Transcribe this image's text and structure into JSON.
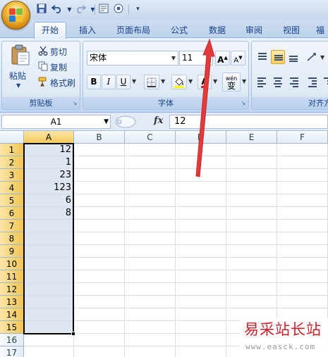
{
  "tabs": [
    {
      "label": "开始",
      "active": true
    },
    {
      "label": "插入"
    },
    {
      "label": "页面布局"
    },
    {
      "label": "公式"
    },
    {
      "label": "数据"
    },
    {
      "label": "审阅"
    },
    {
      "label": "视图"
    },
    {
      "label": "福"
    }
  ],
  "clipboard": {
    "paste": "粘贴",
    "cut": "剪切",
    "copy": "复制",
    "format_painter": "格式刷",
    "group_label": "剪贴板"
  },
  "font": {
    "name": "宋体",
    "size": "11",
    "bold": "B",
    "italic": "I",
    "underline": "U",
    "grow": "A",
    "shrink": "A",
    "phonetic": "wén",
    "phonetic_char": "变",
    "group_label": "字体"
  },
  "alignment": {
    "group_label": "对齐方"
  },
  "formula_bar": {
    "name_box": "A1",
    "fx": "fx",
    "value": "12"
  },
  "grid": {
    "columns": [
      "A",
      "B",
      "C",
      "D",
      "E",
      "F"
    ],
    "rows": [
      "1",
      "2",
      "3",
      "4",
      "5",
      "6",
      "7",
      "8",
      "9",
      "10",
      "11",
      "12",
      "13",
      "14",
      "15",
      "16",
      "17"
    ],
    "values": {
      "A1": "12",
      "A2": "1",
      "A3": "23",
      "A4": "123",
      "A5": "6",
      "A6": "8"
    },
    "selected_range": "A1:A15"
  },
  "watermark": {
    "text": "易采站长站",
    "url": "www.easck.com"
  },
  "colors": {
    "accent_red": "#e03a3a",
    "selection": "#dfe6f2",
    "header_selected": "#f6c958"
  }
}
